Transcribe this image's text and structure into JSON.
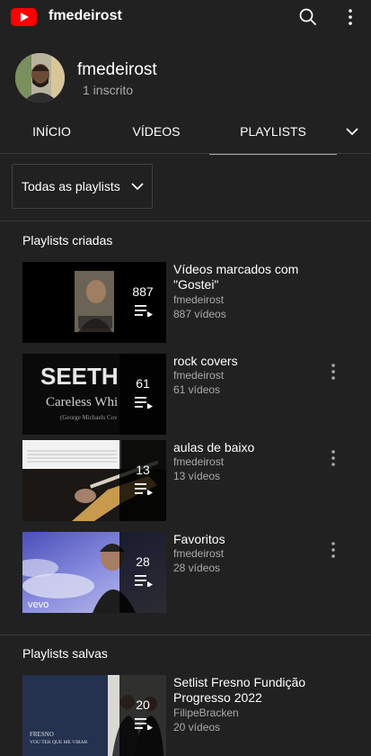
{
  "header": {
    "title": "fmedeirost"
  },
  "channel": {
    "name": "fmedeirost",
    "subscribers": "1 inscrito"
  },
  "tabs": [
    {
      "label": "INÍCIO"
    },
    {
      "label": "VÍDEOS"
    },
    {
      "label": "PLAYLISTS"
    }
  ],
  "filter": {
    "selected": "Todas as playlists"
  },
  "sections": {
    "created": {
      "title": "Playlists criadas",
      "items": [
        {
          "title": "Vídeos marcados com \"Gostei\"",
          "owner": "fmedeirost",
          "videos": "887 vídeos",
          "count": "887"
        },
        {
          "title": "rock covers",
          "owner": "fmedeirost",
          "videos": "61 vídeos",
          "count": "61",
          "thumb_text": {
            "headline": "SEETH",
            "line2": "Careless Whi",
            "line3": "(George Michaels Cov"
          }
        },
        {
          "title": "aulas de baixo",
          "owner": "fmedeirost",
          "videos": "13 vídeos",
          "count": "13"
        },
        {
          "title": "Favoritos",
          "owner": "fmedeirost",
          "videos": "28 vídeos",
          "count": "28",
          "thumb_text": {
            "brand": "vevo"
          }
        }
      ]
    },
    "saved": {
      "title": "Playlists salvas",
      "items": [
        {
          "title": "Setlist Fresno Fundição Progresso 2022",
          "owner": "FilipeBracken",
          "videos": "20 vídeos",
          "count": "20",
          "thumb_text": {
            "line1": "FRESNO",
            "line2": "VOU TER QUE ME VIRAR"
          }
        }
      ]
    }
  },
  "colors": {
    "background": "#212121",
    "brand_red": "#ff0000",
    "secondary_text": "#aaaaaa"
  }
}
